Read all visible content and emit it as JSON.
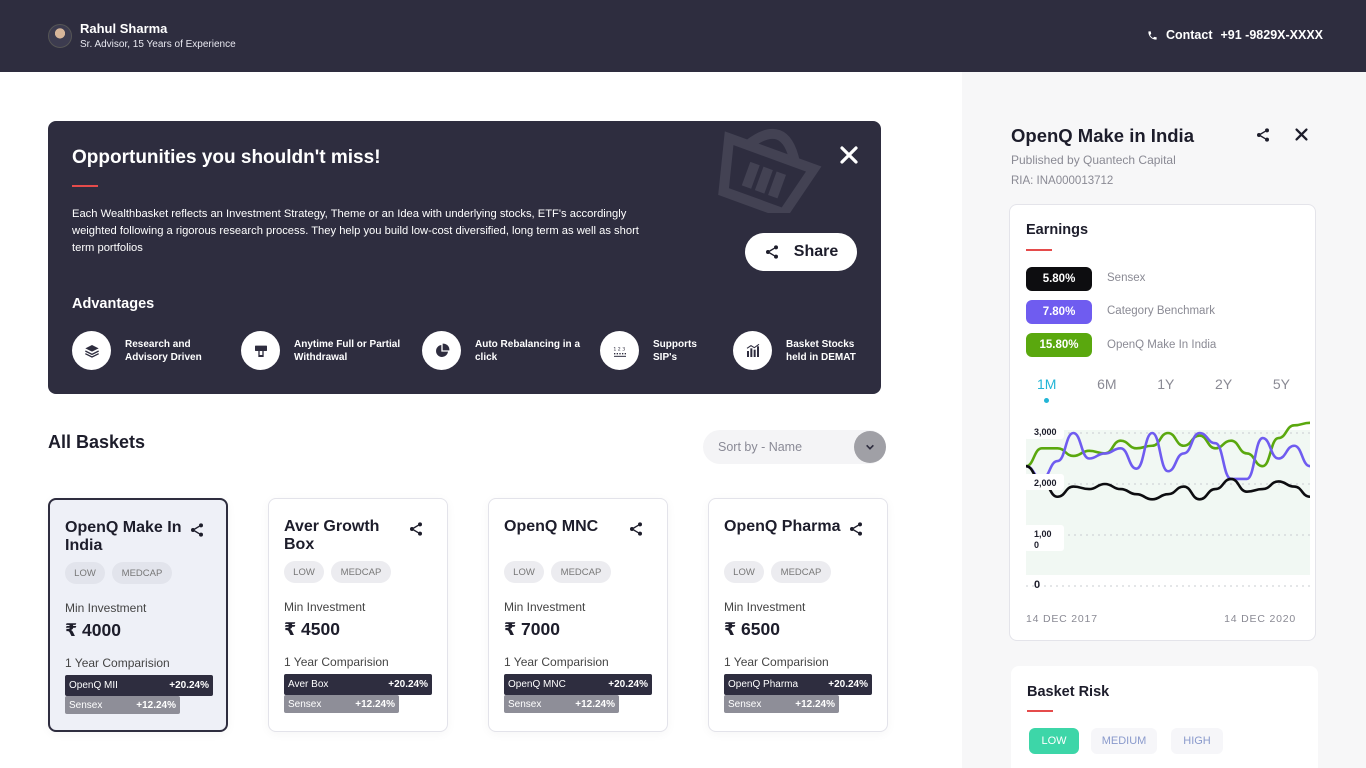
{
  "header": {
    "advisor_name": "Rahul Sharma",
    "advisor_subtitle": "Sr. Advisor, 15 Years of Experience",
    "contact_label": "Contact",
    "contact_number": "+91 -9829X-XXXX"
  },
  "hero": {
    "title": "Opportunities you shouldn't miss!",
    "description": "Each Wealthbasket reflects an Investment Strategy, Theme or an Idea with underlying stocks, ETF's accordingly weighted following a rigorous research process. They help you build low-cost diversified, long term as well as short term portfolios",
    "share_label": "Share",
    "advantages_title": "Advantages",
    "advantages": [
      {
        "label": "Research and Advisory Driven",
        "icon": "layers-icon"
      },
      {
        "label": "Anytime Full or Partial Withdrawal",
        "icon": "withdraw-icon"
      },
      {
        "label": "Auto Rebalancing in a click",
        "icon": "pie-chart-icon"
      },
      {
        "label": "Supports SIP's",
        "icon": "sip-icon"
      },
      {
        "label": "Basket Stocks held in DEMAT",
        "icon": "stocks-icon"
      }
    ]
  },
  "baskets": {
    "title": "All Baskets",
    "sort_placeholder": "Sort by - Name",
    "min_investment_label": "Min Investment",
    "comparison_label": "1 Year Comparision",
    "items": [
      {
        "name": "OpenQ Make In India",
        "risk": "LOW",
        "cap": "MEDCAP",
        "min": "₹ 4000",
        "short": "OpenQ MII",
        "basket_return": "+20.24%",
        "index": "Sensex",
        "index_return": "+12.24%"
      },
      {
        "name": "Aver Growth Box",
        "risk": "LOW",
        "cap": "MEDCAP",
        "min": "₹ 4500",
        "short": "Aver Box",
        "basket_return": "+20.24%",
        "index": "Sensex",
        "index_return": "+12.24%"
      },
      {
        "name": "OpenQ MNC",
        "risk": "LOW",
        "cap": "MEDCAP",
        "min": "₹ 7000",
        "short": "OpenQ MNC",
        "basket_return": "+20.24%",
        "index": "Sensex",
        "index_return": "+12.24%"
      },
      {
        "name": "OpenQ Pharma",
        "risk": "LOW",
        "cap": "MEDCAP",
        "min": "₹ 6500",
        "short": "OpenQ Pharma",
        "basket_return": "+20.24%",
        "index": "Sensex",
        "index_return": "+12.24%"
      }
    ]
  },
  "detail": {
    "title": "OpenQ Make in India",
    "publisher": "Published by Quantech Capital",
    "ria": "RIA: INA000013712",
    "earnings_title": "Earnings",
    "returns": [
      {
        "value": "5.80%",
        "label": "Sensex",
        "color": "#0d0d10"
      },
      {
        "value": "7.80%",
        "label": "Category Benchmark",
        "color": "#6f5cf0"
      },
      {
        "value": "15.80%",
        "label": "OpenQ Make In India",
        "color": "#5aa80e"
      }
    ],
    "periods": [
      "1M",
      "6M",
      "1Y",
      "2Y",
      "5Y"
    ],
    "active_period": "1M",
    "date_start": "14 DEC 2017",
    "date_end": "14 DEC 2020",
    "risk_title": "Basket Risk",
    "risk_levels": [
      "LOW",
      "MEDIUM",
      "HIGH"
    ],
    "risk_selected": "LOW"
  },
  "chart_data": {
    "type": "line",
    "title": "",
    "y_tick_labels": [
      "3,000",
      "2,000",
      "1,00\n0",
      "0"
    ],
    "ylim": [
      0,
      3000
    ],
    "x_range": [
      "14 DEC 2017",
      "14 DEC 2020"
    ],
    "grid": true,
    "series": [
      {
        "name": "OpenQ Make In India",
        "color": "#5aa80e",
        "values": [
          2350,
          2700,
          2700,
          2550,
          2650,
          2600,
          2850,
          2700,
          2750,
          3000,
          2750,
          2950,
          2700,
          2850,
          2600,
          2350,
          2900,
          3150,
          3200
        ]
      },
      {
        "name": "Category Benchmark",
        "color": "#6f5cf0",
        "values": [
          2350,
          2100,
          2450,
          3000,
          2500,
          2600,
          2700,
          2300,
          3000,
          2250,
          2600,
          3000,
          2800,
          2100,
          2100,
          2900,
          2500,
          2750,
          2350
        ]
      },
      {
        "name": "Sensex",
        "color": "#0d0d10",
        "values": [
          2350,
          2050,
          1750,
          1950,
          1900,
          2000,
          1900,
          1800,
          1700,
          1800,
          1950,
          1700,
          1900,
          2100,
          1850,
          1900,
          2050,
          1950,
          1750
        ]
      }
    ]
  }
}
